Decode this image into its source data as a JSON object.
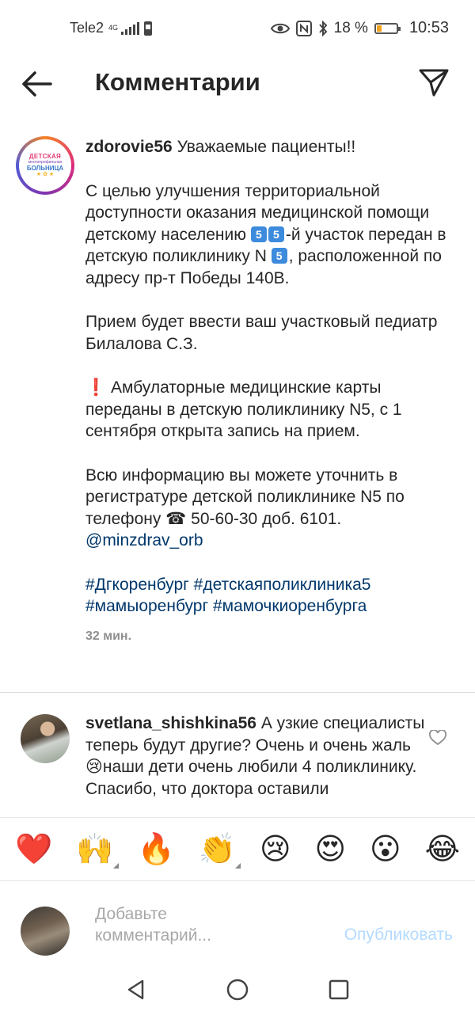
{
  "status_bar": {
    "carrier": "Tele2",
    "network": "4G",
    "battery_percent": "18 %",
    "time": "10:53",
    "icons": [
      "signal-icon",
      "sim-icon",
      "eye-icon",
      "nfc-icon",
      "bluetooth-icon",
      "battery-icon"
    ]
  },
  "header": {
    "title": "Комментарии"
  },
  "post": {
    "avatar_logo": {
      "line1": "ДЕТСКАЯ",
      "line2": "многопрофильная",
      "line3": "БОЛЬНИЦА",
      "decoration": "★ ✿ ★"
    },
    "username": "zdorovie56",
    "intro": "Уважаемые пациенты!!",
    "para1_a": "С целью улучшения территориальной доступности оказания медицинской помощи детскому населению",
    "key5": "5",
    "para1_b": "-й участок передан в детскую поликлинику N",
    "para1_c": ", расположенной по адресу пр-т Победы 140В.",
    "para2": "Прием будет ввести ваш участковый педиатр Билалова С.З.",
    "exclamation": "❗",
    "para3": "Амбулаторные медицинские карты переданы в детскую поликлинику N5, с 1 сентября открыта запись на прием.",
    "para4": "Всю информацию вы можете уточнить в регистратуре детской поликлинике N5 по телефону ☎ 50-60-30 доб. 6101.",
    "mention": "@minzdrav_orb",
    "hashtag1": "#Дгкоренбург",
    "hashtag2": "#детскаяполиклиника5",
    "hashtag3": "#мамыоренбург",
    "hashtag4": "#мамочкиоренбурга",
    "time": "32 мин."
  },
  "comment": {
    "username": "svetlana_shishkina56",
    "text_a": "А узкие специалисты  теперь будут другие? Очень и очень жаль",
    "emoji": "😢",
    "text_b": "наши дети очень любили 4 поликлинику. Спасибо, что доктора оставили"
  },
  "reactions": [
    "❤️",
    "🙌",
    "🔥",
    "👏",
    "😢",
    "😍",
    "😮",
    "😂"
  ],
  "composer": {
    "placeholder": "Добавьте комментарий...",
    "publish": "Опубликовать"
  },
  "navbar": [
    "back-triangle-icon",
    "home-circle-icon",
    "recents-square-icon"
  ]
}
